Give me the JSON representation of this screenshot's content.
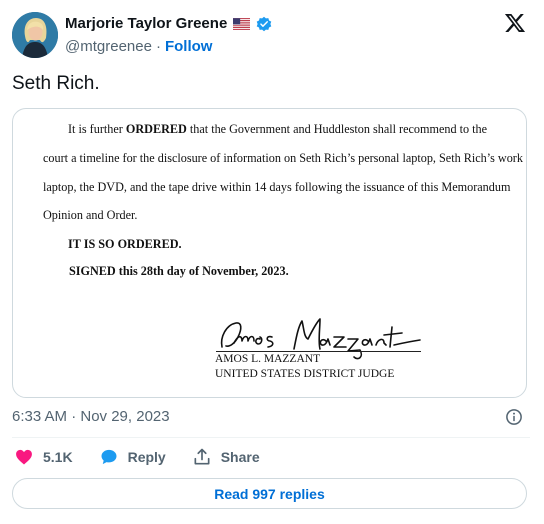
{
  "author": {
    "name": "Marjorie Taylor Greene",
    "handle": "@mtgreenee",
    "separator": "·",
    "follow_label": "Follow"
  },
  "tweet": {
    "text": "Seth Rich."
  },
  "document": {
    "line1_prefix": "It is further ",
    "line1_bold": "ORDERED",
    "line1_suffix": " that the Government and Huddleston shall recommend to the",
    "line2": "court a timeline for the disclosure of information on Seth Rich’s personal laptop, Seth Rich’s work",
    "line3": "laptop, the DVD, and the tape drive within 14 days following the issuance of this Memorandum",
    "line4": "Opinion and Order.",
    "so_ordered": "IT IS SO ORDERED.",
    "signed": "SIGNED this 28th day of November, 2023.",
    "signature": "Amos Mazzant",
    "judge_name": "AMOS L. MAZZANT",
    "judge_title": "UNITED STATES DISTRICT JUDGE"
  },
  "meta": {
    "timestamp": "6:33 AM · Nov 29, 2023"
  },
  "actions": {
    "likes": "5.1K",
    "reply_label": "Reply",
    "share_label": "Share"
  },
  "replies_button": "Read 997 replies",
  "colors": {
    "like": "#f91880",
    "reply": "#1d9bf0",
    "follow": "#006fd6",
    "verified": "#1d9bf0",
    "muted": "#536471",
    "border": "#cfd9de"
  },
  "icons": [
    "us-flag-icon",
    "verified-badge-icon",
    "x-logo-icon",
    "info-icon",
    "heart-icon",
    "reply-bubble-icon",
    "share-icon"
  ]
}
